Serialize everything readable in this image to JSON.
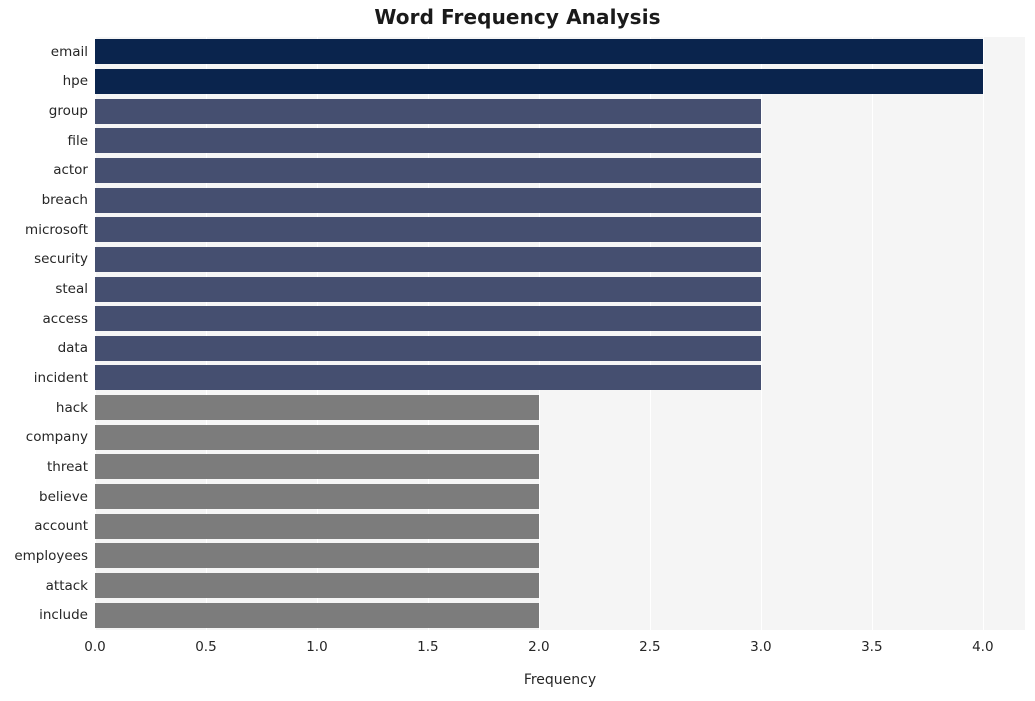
{
  "chart_data": {
    "type": "bar",
    "orientation": "horizontal",
    "title": "Word Frequency Analysis",
    "xlabel": "Frequency",
    "ylabel": "",
    "categories": [
      "email",
      "hpe",
      "group",
      "file",
      "actor",
      "breach",
      "microsoft",
      "security",
      "steal",
      "access",
      "data",
      "incident",
      "hack",
      "company",
      "threat",
      "believe",
      "account",
      "employees",
      "attack",
      "include"
    ],
    "values": [
      4,
      4,
      3,
      3,
      3,
      3,
      3,
      3,
      3,
      3,
      3,
      3,
      2,
      2,
      2,
      2,
      2,
      2,
      2,
      2
    ],
    "bar_colors": [
      "#0a244d",
      "#0a244d",
      "#454f70",
      "#454f70",
      "#454f70",
      "#454f70",
      "#454f70",
      "#454f70",
      "#454f70",
      "#454f70",
      "#454f70",
      "#454f70",
      "#7c7c7c",
      "#7c7c7c",
      "#7c7c7c",
      "#7c7c7c",
      "#7c7c7c",
      "#7c7c7c",
      "#7c7c7c",
      "#7c7c7c"
    ],
    "xlim": [
      0.0,
      4.19
    ],
    "xticks": [
      0.0,
      0.5,
      1.0,
      1.5,
      2.0,
      2.5,
      3.0,
      3.5,
      4.0
    ],
    "xticklabels": [
      "0.0",
      "0.5",
      "1.0",
      "1.5",
      "2.0",
      "2.5",
      "3.0",
      "3.5",
      "4.0"
    ],
    "grid": true,
    "grid_axis": "x",
    "grid_color": "#ffffff",
    "plot_background": "#f5f5f5",
    "figure_background": "#ffffff",
    "legend": null
  }
}
